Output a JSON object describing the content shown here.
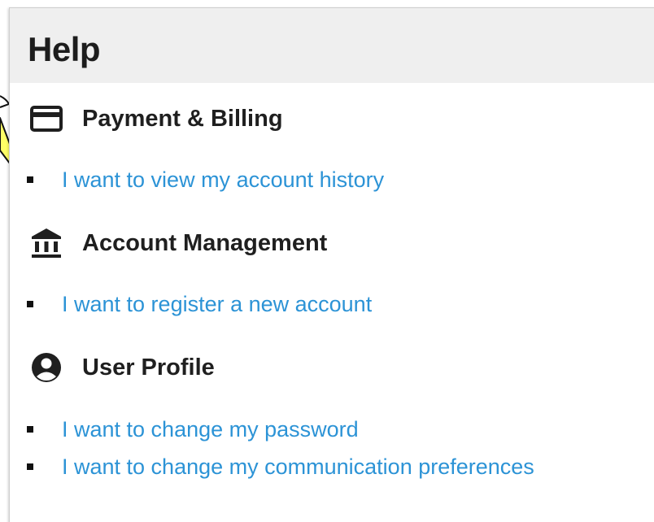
{
  "help": {
    "title": "Help"
  },
  "sections": [
    {
      "label": "Payment & Billing",
      "icon": "credit-card-icon",
      "links": [
        "I want to view my account history"
      ]
    },
    {
      "label": "Account Management",
      "icon": "bank-icon",
      "links": [
        "I want to register a new account"
      ]
    },
    {
      "label": "User Profile",
      "icon": "user-circle-icon",
      "links": [
        "I want to change my password",
        "I want to change my communication preferences"
      ]
    }
  ],
  "colors": {
    "link": "#2c93d6",
    "header_bg": "#efefef",
    "heading_text": "#1f1f1f",
    "callout_fill": "#ffff66"
  }
}
